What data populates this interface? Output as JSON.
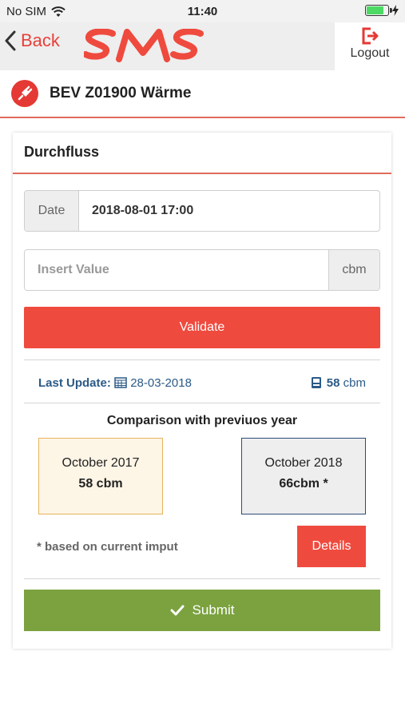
{
  "status_bar": {
    "carrier": "No SIM",
    "time": "11:40"
  },
  "nav": {
    "back_label": "Back",
    "logo_text": "SMS",
    "logout_label": "Logout"
  },
  "header": {
    "title": "BEV Z01900 Wärme",
    "icon": "plug-icon"
  },
  "card": {
    "title": "Durchfluss",
    "date_label": "Date",
    "date_value": "2018-08-01 17:00",
    "value_placeholder": "Insert Value",
    "unit": "cbm",
    "validate_label": "Validate"
  },
  "last_update": {
    "label": "Last Update:",
    "date": "28-03-2018",
    "meter_value": "58",
    "meter_unit": "cbm"
  },
  "comparison": {
    "title": "Comparison with previuos year",
    "prev": {
      "month": "October 2017",
      "value": "58 cbm"
    },
    "curr": {
      "month": "October 2018",
      "value": "66cbm *"
    }
  },
  "footnote": "* based on current imput",
  "details_label": "Details",
  "submit_label": "Submit",
  "colors": {
    "accent": "#ef4a3e",
    "submit": "#7ba23f",
    "link": "#2b5a87"
  }
}
